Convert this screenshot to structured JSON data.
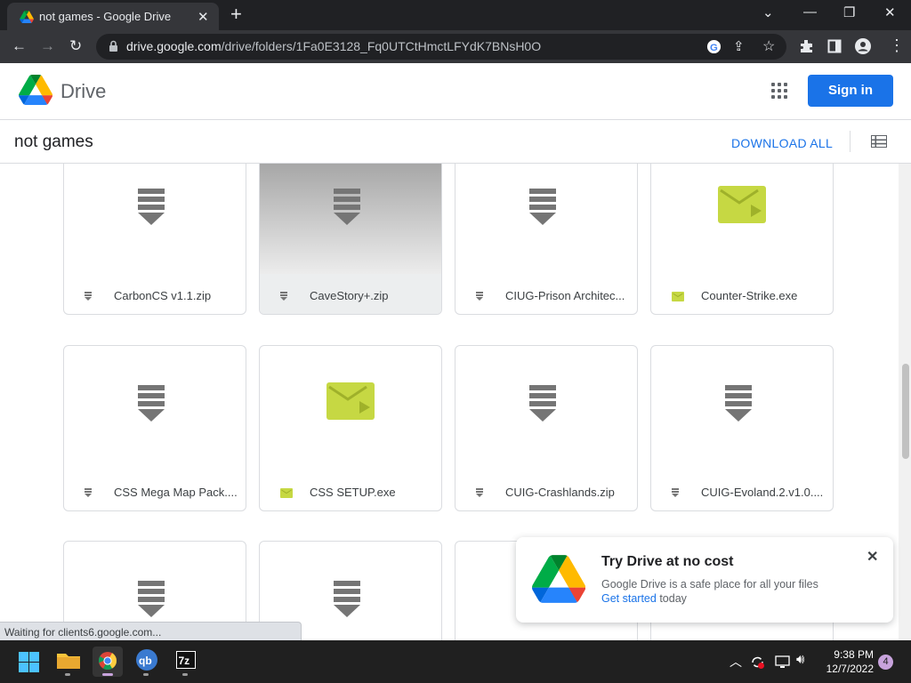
{
  "browser": {
    "tab_title": "not games - Google Drive",
    "url_host": "drive.google.com",
    "url_path": "/drive/folders/1Fa0E3128_Fq0UTCtHmctLFYdK7BNsH0O"
  },
  "drive": {
    "brand": "Drive",
    "signin_label": "Sign in",
    "folder_title": "not games",
    "download_all_label": "DOWNLOAD ALL"
  },
  "files": [
    {
      "name": "CarbonCS v1.1.zip",
      "type": "zip"
    },
    {
      "name": "CaveStory+.zip",
      "type": "zip"
    },
    {
      "name": "CIUG-Prison Architec...",
      "type": "zip"
    },
    {
      "name": "Counter-Strike.exe",
      "type": "exe"
    },
    {
      "name": "CSS Mega Map Pack....",
      "type": "zip"
    },
    {
      "name": "CSS SETUP.exe",
      "type": "exe"
    },
    {
      "name": "CUIG-Crashlands.zip",
      "type": "zip"
    },
    {
      "name": "CUIG-Evoland.2.v1.0....",
      "type": "zip"
    }
  ],
  "promo": {
    "title": "Try Drive at no cost",
    "body": "Google Drive is a safe place for all your files",
    "link": "Get started",
    "suffix": " today"
  },
  "status_text": "Waiting for clients6.google.com...",
  "taskbar": {
    "time": "9:38 PM",
    "date": "12/7/2022",
    "notifications": "4"
  },
  "colors": {
    "accent": "#1a73e8",
    "exe_icon": "#c6d843",
    "zip_icon": "#757575"
  }
}
